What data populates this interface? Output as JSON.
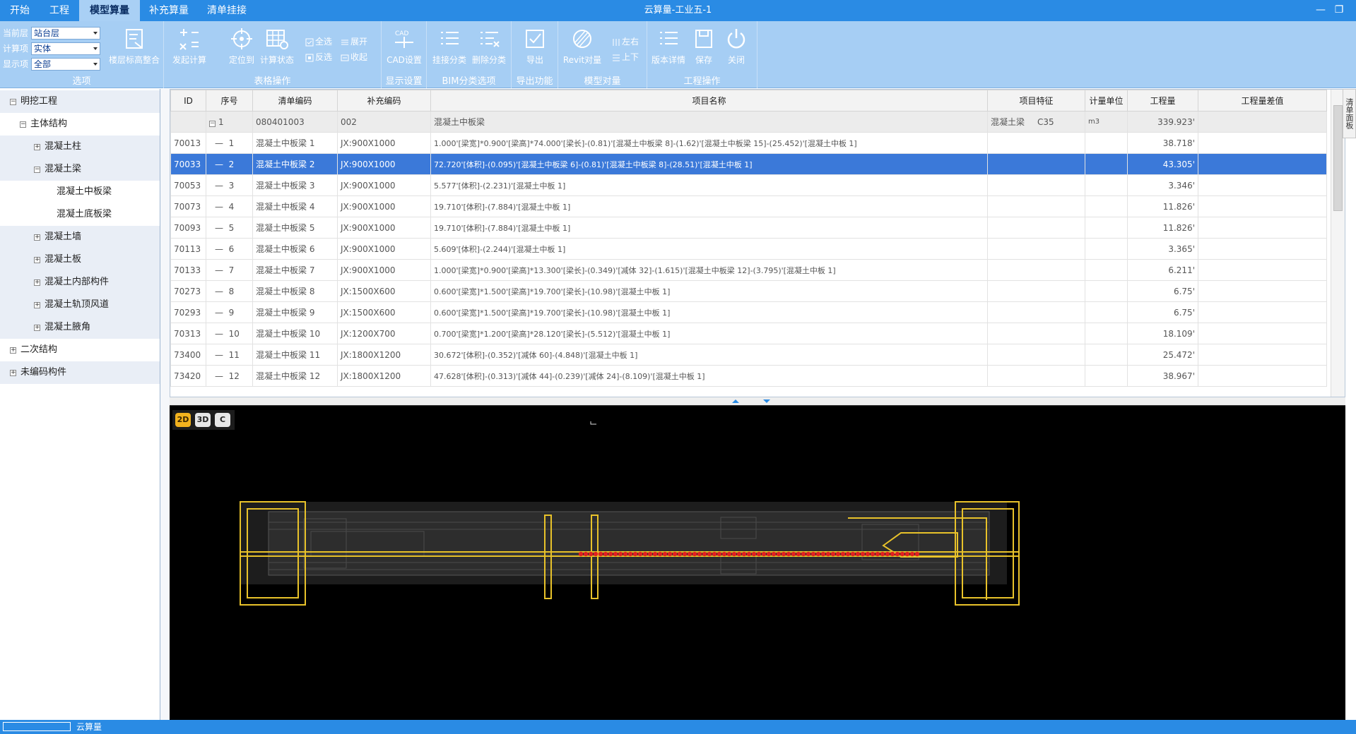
{
  "menu": {
    "tabs": [
      {
        "label": "开始"
      },
      {
        "label": "工程"
      },
      {
        "label": "模型算量"
      },
      {
        "label": "补充算量"
      },
      {
        "label": "清单挂接"
      }
    ],
    "active_index": 2
  },
  "window": {
    "title": "云算量-工业五-1",
    "minimize": "—",
    "restore": "❐"
  },
  "ribbon": {
    "options": {
      "current_floor_label": "当前层",
      "current_floor_value": "站台层",
      "calc_item_label": "计算项",
      "calc_item_value": "实体",
      "display_label": "显示项",
      "display_value": "全部",
      "floor_merge": "楼层标高整合",
      "group_title": "选项"
    },
    "table_ops": {
      "start_calc": "发起计算",
      "locate": "定位到",
      "calc_status": "计算状态",
      "select_all": "全选",
      "invert": "反选",
      "expand": "展开",
      "collapse": "收起",
      "group_title": "表格操作"
    },
    "display": {
      "cad_settings": "CAD设置",
      "group_title": "显示设置"
    },
    "bim": {
      "attach": "挂接分类",
      "delete": "删除分类",
      "group_title": "BIM分类选项"
    },
    "export": {
      "export": "导出",
      "group_title": "导出功能"
    },
    "model": {
      "revit": "Revit对量",
      "left_right": "左右",
      "up_down": "上下",
      "group_title": "模型对量"
    },
    "project": {
      "version": "版本详情",
      "save": "保存",
      "close": "关闭",
      "group_title": "工程操作"
    }
  },
  "tree": {
    "nodes": [
      {
        "label": "明挖工程",
        "toggle": "−",
        "depth": 0,
        "shade": true
      },
      {
        "label": "主体结构",
        "toggle": "−",
        "depth": 1,
        "shade": false
      },
      {
        "label": "混凝土柱",
        "toggle": "+",
        "depth": 2,
        "shade": true
      },
      {
        "label": "混凝土梁",
        "toggle": "−",
        "depth": 2,
        "shade": true
      },
      {
        "label": "混凝土中板梁",
        "toggle": "",
        "depth": 3,
        "shade": false
      },
      {
        "label": "混凝土底板梁",
        "toggle": "",
        "depth": 3,
        "shade": false
      },
      {
        "label": "混凝土墙",
        "toggle": "+",
        "depth": 2,
        "shade": true
      },
      {
        "label": "混凝土板",
        "toggle": "+",
        "depth": 2,
        "shade": true
      },
      {
        "label": "混凝土内部构件",
        "toggle": "+",
        "depth": 2,
        "shade": true
      },
      {
        "label": "混凝土轨顶风道",
        "toggle": "+",
        "depth": 2,
        "shade": true
      },
      {
        "label": "混凝土腋角",
        "toggle": "+",
        "depth": 2,
        "shade": true
      },
      {
        "label": "二次结构",
        "toggle": "+",
        "depth": 0,
        "shade": false
      },
      {
        "label": "未编码构件",
        "toggle": "+",
        "depth": 0,
        "shade": true
      }
    ]
  },
  "grid": {
    "columns": [
      "ID",
      "序号",
      "清单编码",
      "补充编码",
      "项目名称",
      "项目特征",
      "计量单位",
      "工程量",
      "工程量差值"
    ],
    "group_row": {
      "toggle": "−",
      "seq": "1",
      "code": "080401003",
      "supp": "002",
      "name": "混凝土中板梁",
      "feature_a": "混凝土梁",
      "feature_b": "C35",
      "unit": "m3",
      "qty": "339.923'"
    },
    "rows": [
      {
        "id": "70013",
        "seq": "1",
        "code": "混凝土中板梁  1",
        "supp": "JX:900X1000",
        "formula": "1.000'[梁宽]*0.900'[梁高]*74.000'[梁长]-(0.81)'[混凝土中板梁  8]-(1.62)'[混凝土中板梁  15]-(25.452)'[混凝土中板  1]",
        "qty": "38.718'",
        "sel": false
      },
      {
        "id": "70033",
        "seq": "2",
        "code": "混凝土中板梁  2",
        "supp": "JX:900X1000",
        "formula": "72.720'[体积]-(0.095)'[混凝土中板梁  6]-(0.81)'[混凝土中板梁  8]-(28.51)'[混凝土中板  1]",
        "qty": "43.305'",
        "sel": true
      },
      {
        "id": "70053",
        "seq": "3",
        "code": "混凝土中板梁  3",
        "supp": "JX:900X1000",
        "formula": "5.577'[体积]-(2.231)'[混凝土中板  1]",
        "qty": "3.346'",
        "sel": false
      },
      {
        "id": "70073",
        "seq": "4",
        "code": "混凝土中板梁  4",
        "supp": "JX:900X1000",
        "formula": "19.710'[体积]-(7.884)'[混凝土中板  1]",
        "qty": "11.826'",
        "sel": false
      },
      {
        "id": "70093",
        "seq": "5",
        "code": "混凝土中板梁  5",
        "supp": "JX:900X1000",
        "formula": "19.710'[体积]-(7.884)'[混凝土中板  1]",
        "qty": "11.826'",
        "sel": false
      },
      {
        "id": "70113",
        "seq": "6",
        "code": "混凝土中板梁  6",
        "supp": "JX:900X1000",
        "formula": "5.609'[体积]-(2.244)'[混凝土中板  1]",
        "qty": "3.365'",
        "sel": false
      },
      {
        "id": "70133",
        "seq": "7",
        "code": "混凝土中板梁  7",
        "supp": "JX:900X1000",
        "formula": "1.000'[梁宽]*0.900'[梁高]*13.300'[梁长]-(0.349)'[减体  32]-(1.615)'[混凝土中板梁  12]-(3.795)'[混凝土中板  1]",
        "qty": "6.211'",
        "sel": false
      },
      {
        "id": "70273",
        "seq": "8",
        "code": "混凝土中板梁  8",
        "supp": "JX:1500X600",
        "formula": "0.600'[梁宽]*1.500'[梁高]*19.700'[梁长]-(10.98)'[混凝土中板  1]",
        "qty": "6.75'",
        "sel": false
      },
      {
        "id": "70293",
        "seq": "9",
        "code": "混凝土中板梁  9",
        "supp": "JX:1500X600",
        "formula": "0.600'[梁宽]*1.500'[梁高]*19.700'[梁长]-(10.98)'[混凝土中板  1]",
        "qty": "6.75'",
        "sel": false
      },
      {
        "id": "70313",
        "seq": "10",
        "code": "混凝土中板梁  10",
        "supp": "JX:1200X700",
        "formula": "0.700'[梁宽]*1.200'[梁高]*28.120'[梁长]-(5.512)'[混凝土中板  1]",
        "qty": "18.109'",
        "sel": false
      },
      {
        "id": "73400",
        "seq": "11",
        "code": "混凝土中板梁  11",
        "supp": "JX:1800X1200",
        "formula": "30.672'[体积]-(0.352)'[减体  60]-(4.848)'[混凝土中板  1]",
        "qty": "25.472'",
        "sel": false
      },
      {
        "id": "73420",
        "seq": "12",
        "code": "混凝土中板梁  12",
        "supp": "JX:1800X1200",
        "formula": "47.628'[体积]-(0.313)'[减体  44]-(0.239)'[减体  24]-(8.109)'[混凝土中板  1]",
        "qty": "38.967'",
        "sel": false
      }
    ]
  },
  "side_tab": "清单面板",
  "viewer": {
    "btn_2d": "2D",
    "btn_3d": "3D",
    "btn_c": "C"
  },
  "status": {
    "text": "云算量"
  },
  "colors": {
    "accent": "#2a8be4",
    "ribbon": "#a6cef4",
    "selected_row": "#3b79d9",
    "model_yellow": "#e8c22a",
    "model_red": "#e02020"
  }
}
